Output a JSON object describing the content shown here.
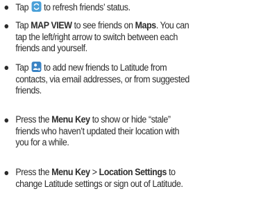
{
  "items": [
    {
      "t1": "Tap",
      "icon": "refresh-icon",
      "t2": "to refresh friends’ status."
    },
    {
      "l1a": "Tap",
      "l1b": "MAP VIEW",
      "l1c": "to see friends on",
      "l1d": "Maps",
      "l1e": ". You can",
      "l2": "tap the left/right arrow to switch between each",
      "l3": "friends and yourself."
    },
    {
      "l1a": "Tap",
      "icon": "add-friend-icon",
      "l1b": "to add new friends to Latitude from",
      "l2": "contacts, via email addresses, or from suggested",
      "l3": "friends."
    },
    {
      "l1a": "Press the",
      "l1b": "Menu Key",
      "l1c": "to show or hide “stale”",
      "l2": "friends who haven’t updated their location with",
      "l3": "you for a while."
    },
    {
      "l1a": "Press the",
      "l1b": "Menu Key",
      "l1c": ">",
      "l1d": "Location Settings",
      "l1e": "to",
      "l2": "change Latitude settings or sign out of Latitude."
    }
  ]
}
